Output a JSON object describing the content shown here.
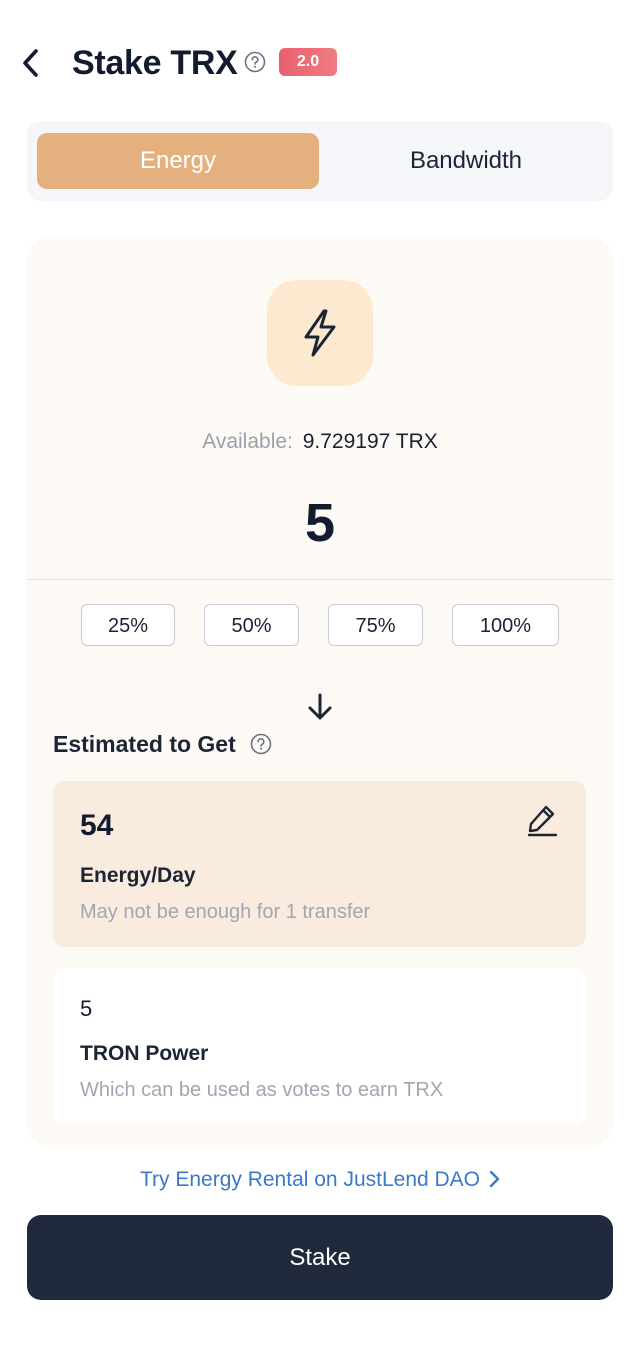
{
  "header": {
    "title": "Stake TRX",
    "version_badge": "2.0"
  },
  "tabs": [
    {
      "label": "Energy",
      "selected": true
    },
    {
      "label": "Bandwidth",
      "selected": false
    }
  ],
  "stake_panel": {
    "available_label": "Available:",
    "available_value": "9.729197 TRX",
    "amount": "5",
    "percent_options": [
      "25%",
      "50%",
      "75%",
      "100%"
    ]
  },
  "estimate": {
    "title": "Estimated to Get",
    "energy": {
      "value": "54",
      "unit": "Energy/Day",
      "note": "May not be enough for 1 transfer"
    },
    "tron_power": {
      "value": "5",
      "unit": "TRON Power",
      "note": "Which can be used as votes to earn TRX"
    }
  },
  "rental_link": "Try Energy Rental on JustLend DAO",
  "stake_button": "Stake",
  "icons": [
    "back-arrow-icon",
    "help-icon",
    "lightning-bolt-icon",
    "arrow-down-icon",
    "edit-pencil-icon",
    "chevron-right-icon"
  ],
  "colors": {
    "accent": "#e3b07e",
    "badge": "#ea5f70",
    "link": "#3a79c9",
    "primary_button": "#212a3d"
  }
}
